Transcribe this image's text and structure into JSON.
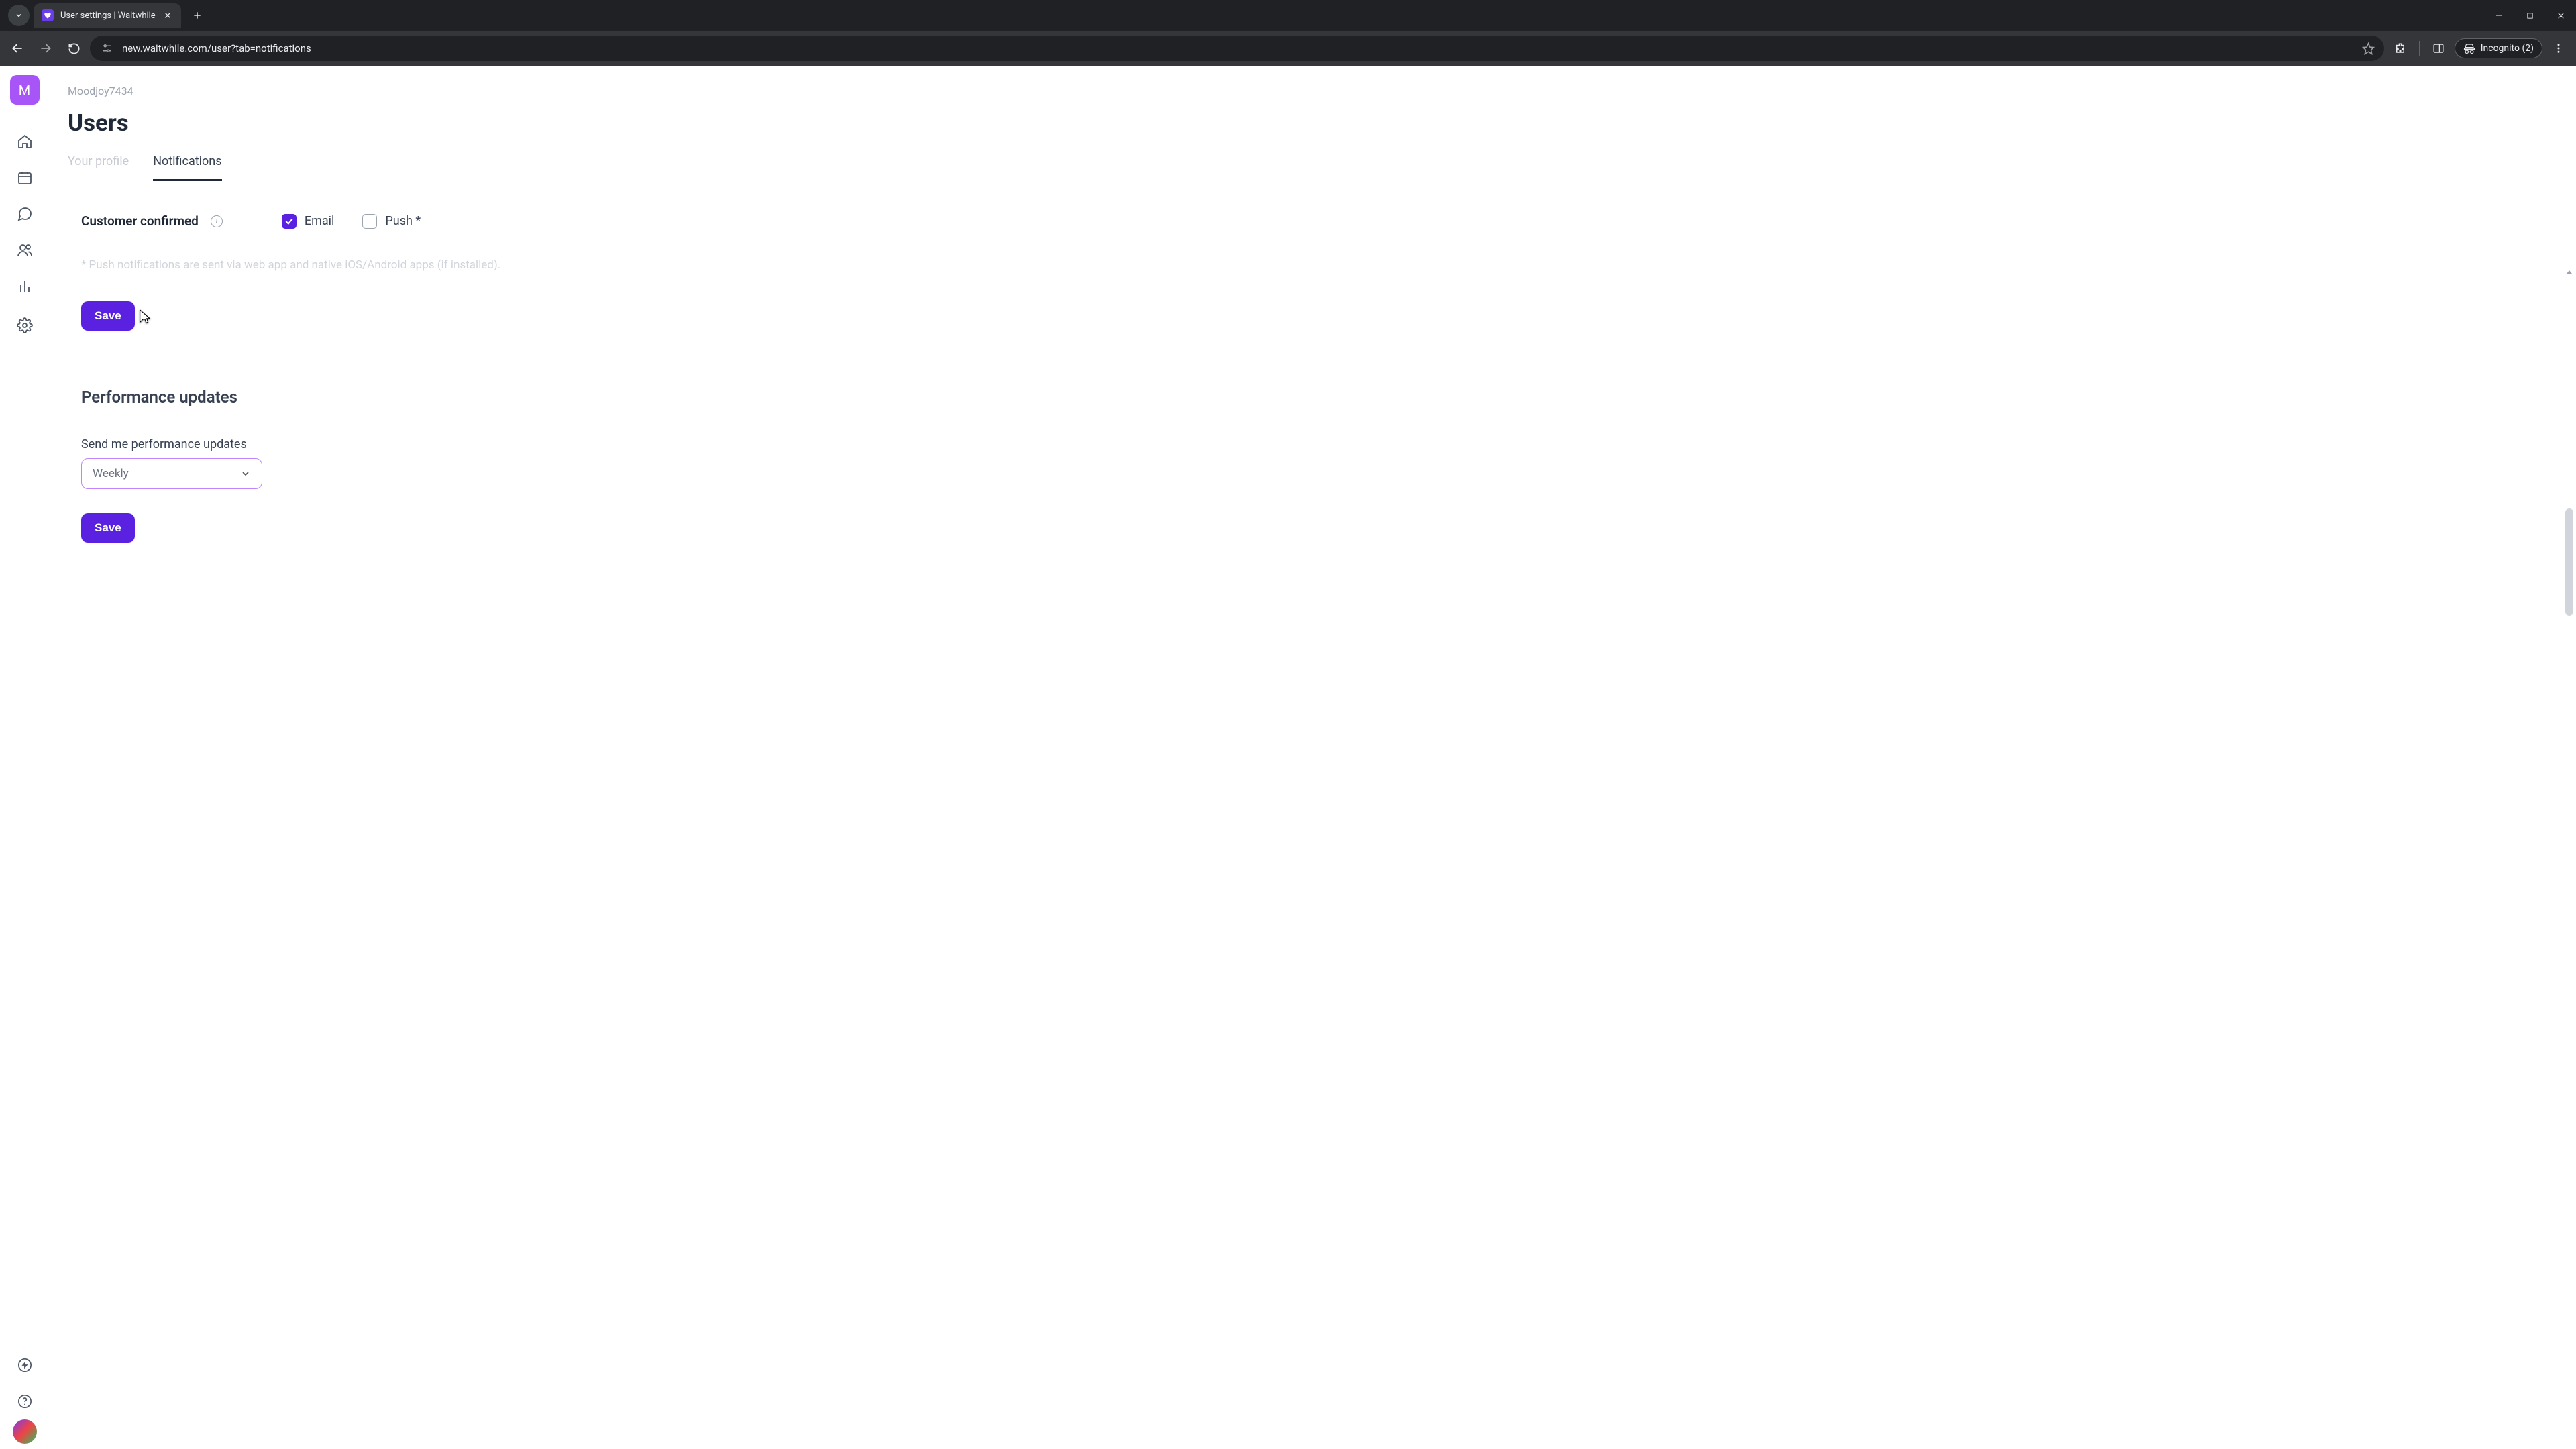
{
  "browser": {
    "tab_title": "User settings | Waitwhile",
    "url": "new.waitwhile.com/user?tab=notifications",
    "incognito_label": "Incognito (2)"
  },
  "sidebar": {
    "avatar_letter": "M"
  },
  "header": {
    "org": "Moodjoy7434",
    "title": "Users",
    "tabs": {
      "profile": "Your profile",
      "notifications": "Notifications"
    }
  },
  "notifications": {
    "customer_confirmed": {
      "label": "Customer confirmed",
      "email_label": "Email",
      "push_label": "Push *",
      "email_checked": true,
      "push_checked": false
    },
    "footnote": "* Push notifications are sent via web app and native iOS/Android apps (if installed).",
    "save_label": "Save"
  },
  "performance": {
    "heading": "Performance updates",
    "field_label": "Send me performance updates",
    "selected": "Weekly",
    "save_label": "Save"
  }
}
